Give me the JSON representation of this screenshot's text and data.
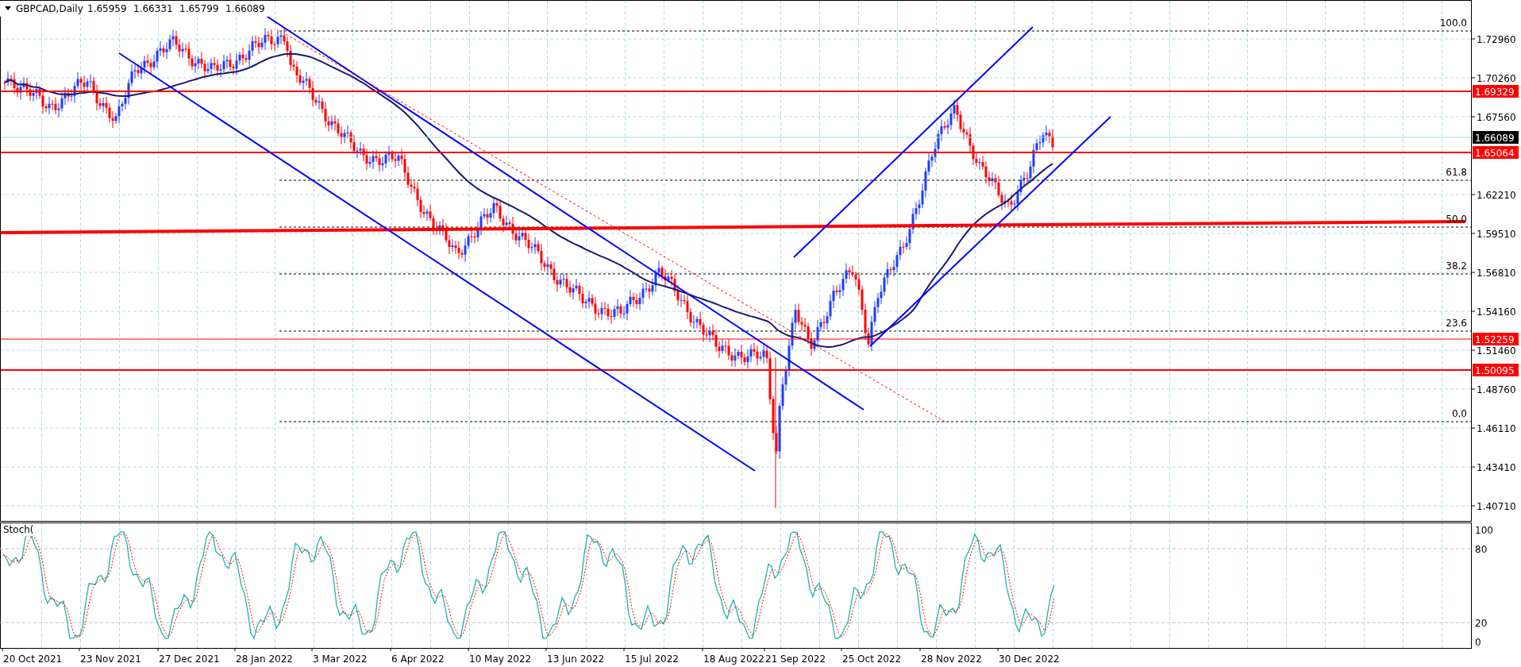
{
  "chart": {
    "symbol": "GBPCAD,Daily",
    "quotes": [
      "1.65959",
      "1.66331",
      "1.65799",
      "1.66089"
    ],
    "price_axis": [
      "1.72960",
      "1.70260",
      "1.67560",
      "1.62210",
      "1.59510",
      "1.56810",
      "1.54160",
      "1.51460",
      "1.48760",
      "1.46110",
      "1.43410",
      "1.40710"
    ],
    "price_tags": [
      {
        "label": "1.69329",
        "color": "#ff0000"
      },
      {
        "label": "1.66089",
        "color": "#000000"
      },
      {
        "label": "1.65064",
        "color": "#ff0000"
      },
      {
        "label": "1.52259",
        "color": "#ff0000"
      },
      {
        "label": "1.50095",
        "color": "#ff0000"
      }
    ],
    "fib_levels": [
      "100.0",
      "61.8",
      "50.0",
      "38.2",
      "23.6",
      "0.0"
    ],
    "indicator": {
      "label": "Stoch(",
      "axis": [
        "100",
        "80",
        "20",
        "0"
      ]
    },
    "time_axis": [
      "20 Oct 2021",
      "23 Nov 2021",
      "27 Dec 2021",
      "28 Jan 2022",
      "3 Mar 2022",
      "6 Apr 2022",
      "10 May 2022",
      "13 Jun 2022",
      "15 Jul 2022",
      "18 Aug 2022",
      "21 Sep 2022",
      "25 Oct 2022",
      "28 Nov 2022",
      "30 Dec 2022"
    ]
  }
}
